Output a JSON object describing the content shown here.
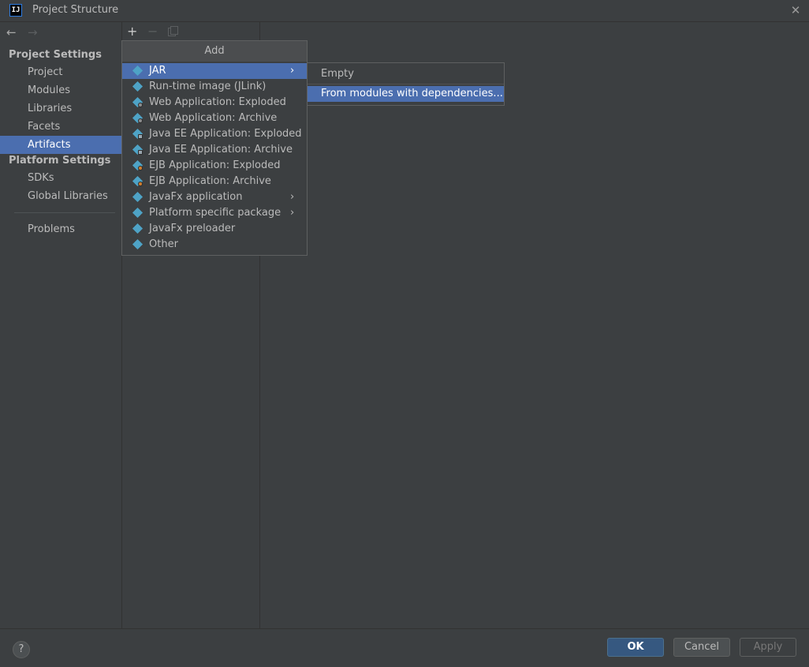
{
  "window": {
    "app_icon_text": "IJ",
    "title": "Project Structure",
    "close_glyph": "✕"
  },
  "nav": {
    "back_glyph": "←",
    "forward_glyph": "→"
  },
  "sidebar": {
    "project_settings_header": "Project Settings",
    "project_items": [
      {
        "label": "Project"
      },
      {
        "label": "Modules"
      },
      {
        "label": "Libraries"
      },
      {
        "label": "Facets"
      },
      {
        "label": "Artifacts",
        "selected": true
      }
    ],
    "platform_settings_header": "Platform Settings",
    "platform_items": [
      {
        "label": "SDKs"
      },
      {
        "label": "Global Libraries"
      }
    ],
    "problems_label": "Problems"
  },
  "toolbar": {
    "add_glyph": "+",
    "remove_glyph": "−"
  },
  "add_popup": {
    "header": "Add",
    "items": [
      {
        "label": "JAR",
        "icon": "jar-icon",
        "has_submenu": true,
        "selected": true
      },
      {
        "label": "Run-time image (JLink)",
        "icon": "jar-icon"
      },
      {
        "label": "Web Application: Exploded",
        "icon": "web-exploded-icon"
      },
      {
        "label": "Web Application: Archive",
        "icon": "web-archive-icon"
      },
      {
        "label": "Java EE Application: Exploded",
        "icon": "javaee-exploded-icon"
      },
      {
        "label": "Java EE Application: Archive",
        "icon": "javaee-archive-icon"
      },
      {
        "label": "EJB Application: Exploded",
        "icon": "ejb-exploded-icon"
      },
      {
        "label": "EJB Application: Archive",
        "icon": "ejb-archive-icon"
      },
      {
        "label": "JavaFx application",
        "icon": "jar-icon",
        "has_submenu": true
      },
      {
        "label": "Platform specific package",
        "icon": "jar-icon",
        "has_submenu": true
      },
      {
        "label": "JavaFx preloader",
        "icon": "jar-icon"
      },
      {
        "label": "Other",
        "icon": "jar-icon"
      }
    ],
    "submenu_arrow": "›"
  },
  "jar_submenu": {
    "items": [
      {
        "label": "Empty"
      },
      {
        "label": "From modules with dependencies...",
        "selected": true
      }
    ]
  },
  "footer": {
    "help_label": "?",
    "ok_label": "OK",
    "cancel_label": "Cancel",
    "apply_label": "Apply"
  },
  "colors": {
    "background": "#3c3f41",
    "selection": "#4b6eaf",
    "primary_button": "#365880",
    "icon_accent": "#4ea3c6"
  }
}
